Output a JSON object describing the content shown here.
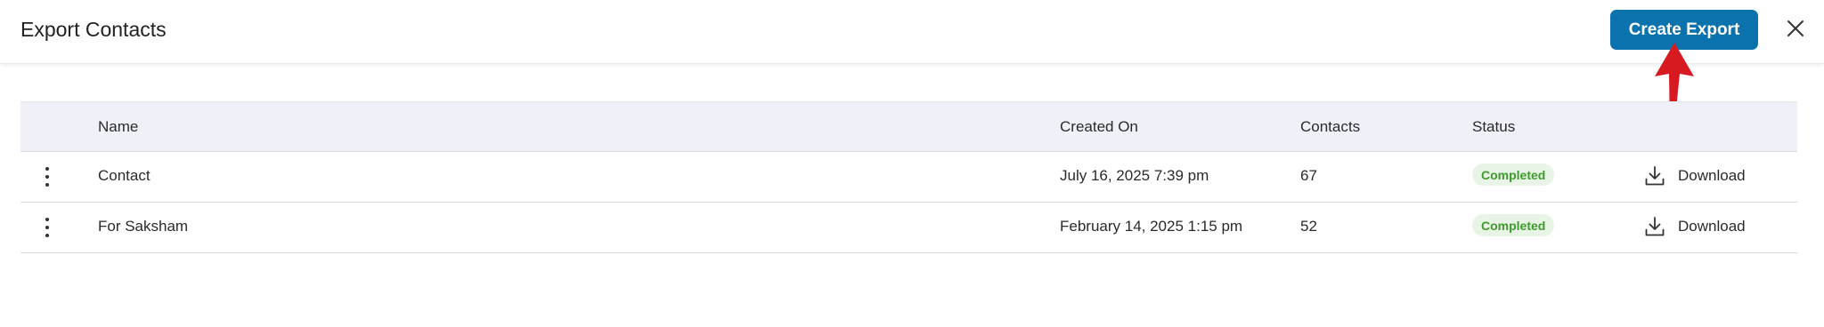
{
  "header": {
    "title": "Export Contacts",
    "create_button_label": "Create Export",
    "close_icon": "close-icon"
  },
  "annotation": {
    "arrow_icon": "red-arrow-up-icon",
    "color": "#d71920"
  },
  "table": {
    "columns": [
      "",
      "Name",
      "Created On",
      "Contacts",
      "Status",
      ""
    ],
    "rows": [
      {
        "name": "Contact",
        "created_on": "July 16, 2025 7:39 pm",
        "contacts": "67",
        "status": "Completed",
        "action": "Download"
      },
      {
        "name": "For Saksham",
        "created_on": "February 14, 2025 1:15 pm",
        "contacts": "52",
        "status": "Completed",
        "action": "Download"
      }
    ]
  },
  "colors": {
    "primary": "#0a73ad",
    "status_completed_text": "#3e9a2c",
    "status_completed_bg": "#e8f4e5",
    "table_header_bg": "#f0f1f8"
  }
}
